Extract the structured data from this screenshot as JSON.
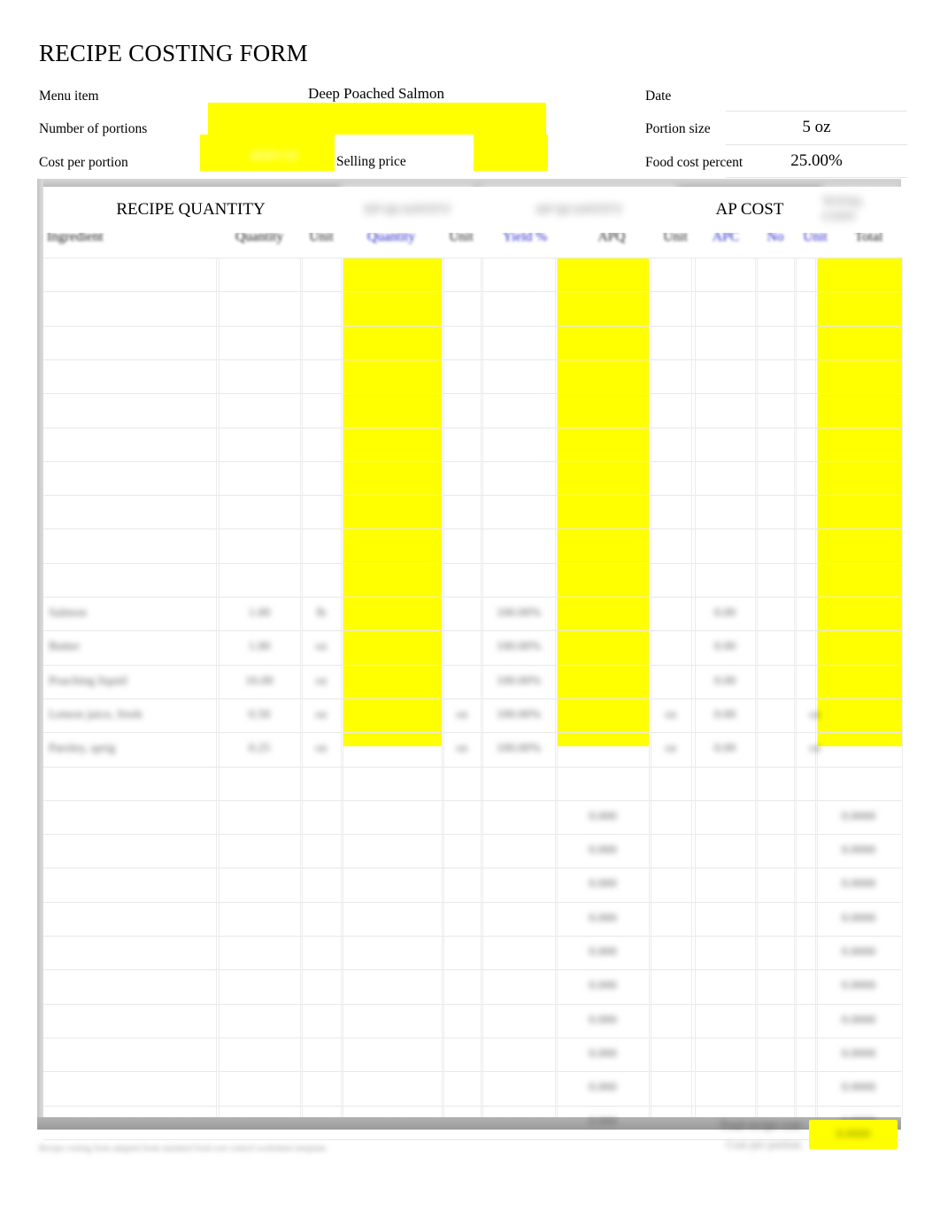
{
  "document": {
    "title": "RECIPE COSTING FORM",
    "footnote": "Recipe costing form adapted from standard food cost control worksheet template."
  },
  "header": {
    "labels": {
      "menu_item": "Menu item",
      "number_of_portions": "Number of portions",
      "cost_per_portion": "Cost per portion",
      "selling_price": "Selling price",
      "date": "Date",
      "portion_size": "Portion size",
      "food_cost_percent": "Food cost percent"
    },
    "values": {
      "menu_item": "Deep Poached Salmon",
      "number_of_portions": "",
      "cost_per_portion": "#DIV/0!",
      "selling_price": "",
      "date": "",
      "portion_size": "5 oz",
      "food_cost_percent": "25.00%"
    }
  },
  "table": {
    "sections": [
      {
        "label": "RECIPE QUANTITY",
        "blurred": false
      },
      {
        "label": "EP QUANTITY",
        "blurred": true
      },
      {
        "label": "AP QUANTITY",
        "blurred": true
      },
      {
        "label": "AP COST",
        "blurred": false
      },
      {
        "label": "TOTAL COST",
        "blurred": true
      }
    ],
    "columns": [
      {
        "label": "Ingredient",
        "color": "dark"
      },
      {
        "label": "Quantity",
        "color": "dark"
      },
      {
        "label": "Unit",
        "color": "dark"
      },
      {
        "label": "Quantity",
        "color": "blue"
      },
      {
        "label": "Unit",
        "color": "dark"
      },
      {
        "label": "Yield %",
        "color": "blue"
      },
      {
        "label": "APQ",
        "color": "dark"
      },
      {
        "label": "Unit",
        "color": "dark"
      },
      {
        "label": "APC",
        "color": "blue"
      },
      {
        "label": "No",
        "color": "blue"
      },
      {
        "label": "Unit",
        "color": "blue"
      },
      {
        "label": "Total",
        "color": "dark"
      }
    ],
    "rows": [
      {
        "ingredient": "",
        "quantity": "",
        "unit": "",
        "ep_quantity": "",
        "ep_unit": "",
        "yield": "",
        "apq": "",
        "ap_unit": "",
        "apc": "",
        "no": "",
        "apc_unit": "",
        "total": ""
      },
      {
        "ingredient": "",
        "quantity": "",
        "unit": "",
        "ep_quantity": "",
        "ep_unit": "",
        "yield": "",
        "apq": "",
        "ap_unit": "",
        "apc": "",
        "no": "",
        "apc_unit": "",
        "total": ""
      },
      {
        "ingredient": "",
        "quantity": "",
        "unit": "",
        "ep_quantity": "",
        "ep_unit": "",
        "yield": "",
        "apq": "",
        "ap_unit": "",
        "apc": "",
        "no": "",
        "apc_unit": "",
        "total": ""
      },
      {
        "ingredient": "",
        "quantity": "",
        "unit": "",
        "ep_quantity": "",
        "ep_unit": "",
        "yield": "",
        "apq": "",
        "ap_unit": "",
        "apc": "",
        "no": "",
        "apc_unit": "",
        "total": ""
      },
      {
        "ingredient": "",
        "quantity": "",
        "unit": "",
        "ep_quantity": "",
        "ep_unit": "",
        "yield": "",
        "apq": "",
        "ap_unit": "",
        "apc": "",
        "no": "",
        "apc_unit": "",
        "total": ""
      },
      {
        "ingredient": "",
        "quantity": "",
        "unit": "",
        "ep_quantity": "",
        "ep_unit": "",
        "yield": "",
        "apq": "",
        "ap_unit": "",
        "apc": "",
        "no": "",
        "apc_unit": "",
        "total": ""
      },
      {
        "ingredient": "",
        "quantity": "",
        "unit": "",
        "ep_quantity": "",
        "ep_unit": "",
        "yield": "",
        "apq": "",
        "ap_unit": "",
        "apc": "",
        "no": "",
        "apc_unit": "",
        "total": ""
      },
      {
        "ingredient": "",
        "quantity": "",
        "unit": "",
        "ep_quantity": "",
        "ep_unit": "",
        "yield": "",
        "apq": "",
        "ap_unit": "",
        "apc": "",
        "no": "",
        "apc_unit": "",
        "total": ""
      },
      {
        "ingredient": "",
        "quantity": "",
        "unit": "",
        "ep_quantity": "",
        "ep_unit": "",
        "yield": "",
        "apq": "",
        "ap_unit": "",
        "apc": "",
        "no": "",
        "apc_unit": "",
        "total": ""
      },
      {
        "ingredient": "",
        "quantity": "",
        "unit": "",
        "ep_quantity": "",
        "ep_unit": "",
        "yield": "",
        "apq": "",
        "ap_unit": "",
        "apc": "",
        "no": "",
        "apc_unit": "",
        "total": ""
      },
      {
        "ingredient": "Salmon",
        "quantity": "1.00",
        "unit": "lb",
        "ep_quantity": "",
        "ep_unit": "",
        "yield": "100.00%",
        "apq": "",
        "ap_unit": "",
        "apc": "0.00",
        "no": "",
        "apc_unit": "",
        "total": ""
      },
      {
        "ingredient": "Butter",
        "quantity": "1.00",
        "unit": "oz",
        "ep_quantity": "",
        "ep_unit": "",
        "yield": "100.00%",
        "apq": "",
        "ap_unit": "",
        "apc": "0.00",
        "no": "",
        "apc_unit": "",
        "total": ""
      },
      {
        "ingredient": "Poaching liquid",
        "quantity": "16.00",
        "unit": "oz",
        "ep_quantity": "",
        "ep_unit": "",
        "yield": "100.00%",
        "apq": "",
        "ap_unit": "",
        "apc": "0.00",
        "no": "",
        "apc_unit": "",
        "total": ""
      },
      {
        "ingredient": "Lemon juice, fresh",
        "quantity": "0.50",
        "unit": "oz",
        "ep_quantity": "",
        "ep_unit": "oz",
        "yield": "100.00%",
        "apq": "",
        "ap_unit": "oz",
        "apc": "0.00",
        "no": "",
        "apc_unit": "oz",
        "total": ""
      },
      {
        "ingredient": "Parsley, sprig",
        "quantity": "0.25",
        "unit": "oz",
        "ep_quantity": "",
        "ep_unit": "oz",
        "yield": "100.00%",
        "apq": "",
        "ap_unit": "oz",
        "apc": "0.00",
        "no": "",
        "apc_unit": "oz",
        "total": ""
      },
      {
        "ingredient": "",
        "quantity": "",
        "unit": "",
        "ep_quantity": "",
        "ep_unit": "",
        "yield": "",
        "apq": "",
        "ap_unit": "",
        "apc": "",
        "no": "",
        "apc_unit": "",
        "total": ""
      },
      {
        "ingredient": "",
        "quantity": "",
        "unit": "",
        "ep_quantity": "",
        "ep_unit": "",
        "yield": "",
        "apq": "0.000",
        "ap_unit": "",
        "apc": "",
        "no": "",
        "apc_unit": "",
        "total": "0.0000"
      },
      {
        "ingredient": "",
        "quantity": "",
        "unit": "",
        "ep_quantity": "",
        "ep_unit": "",
        "yield": "",
        "apq": "0.000",
        "ap_unit": "",
        "apc": "",
        "no": "",
        "apc_unit": "",
        "total": "0.0000"
      },
      {
        "ingredient": "",
        "quantity": "",
        "unit": "",
        "ep_quantity": "",
        "ep_unit": "",
        "yield": "",
        "apq": "0.000",
        "ap_unit": "",
        "apc": "",
        "no": "",
        "apc_unit": "",
        "total": "0.0000"
      },
      {
        "ingredient": "",
        "quantity": "",
        "unit": "",
        "ep_quantity": "",
        "ep_unit": "",
        "yield": "",
        "apq": "0.000",
        "ap_unit": "",
        "apc": "",
        "no": "",
        "apc_unit": "",
        "total": "0.0000"
      },
      {
        "ingredient": "",
        "quantity": "",
        "unit": "",
        "ep_quantity": "",
        "ep_unit": "",
        "yield": "",
        "apq": "0.000",
        "ap_unit": "",
        "apc": "",
        "no": "",
        "apc_unit": "",
        "total": "0.0000"
      },
      {
        "ingredient": "",
        "quantity": "",
        "unit": "",
        "ep_quantity": "",
        "ep_unit": "",
        "yield": "",
        "apq": "0.000",
        "ap_unit": "",
        "apc": "",
        "no": "",
        "apc_unit": "",
        "total": "0.0000"
      },
      {
        "ingredient": "",
        "quantity": "",
        "unit": "",
        "ep_quantity": "",
        "ep_unit": "",
        "yield": "",
        "apq": "0.000",
        "ap_unit": "",
        "apc": "",
        "no": "",
        "apc_unit": "",
        "total": "0.0000"
      },
      {
        "ingredient": "",
        "quantity": "",
        "unit": "",
        "ep_quantity": "",
        "ep_unit": "",
        "yield": "",
        "apq": "0.000",
        "ap_unit": "",
        "apc": "",
        "no": "",
        "apc_unit": "",
        "total": "0.0000"
      },
      {
        "ingredient": "",
        "quantity": "",
        "unit": "",
        "ep_quantity": "",
        "ep_unit": "",
        "yield": "",
        "apq": "0.000",
        "ap_unit": "",
        "apc": "",
        "no": "",
        "apc_unit": "",
        "total": "0.0000"
      },
      {
        "ingredient": "",
        "quantity": "",
        "unit": "",
        "ep_quantity": "",
        "ep_unit": "",
        "yield": "",
        "apq": "0.000",
        "ap_unit": "",
        "apc": "",
        "no": "",
        "apc_unit": "",
        "total": "0.0000"
      }
    ]
  },
  "totals": {
    "label": "Total recipe cost",
    "sublabel": "Cost per portion",
    "value": "0.0000"
  },
  "colors": {
    "highlight": "#ffff00",
    "blue_header": "#2222cc",
    "grid_line": "#e8e8e8",
    "band": "#b2b2b2"
  }
}
